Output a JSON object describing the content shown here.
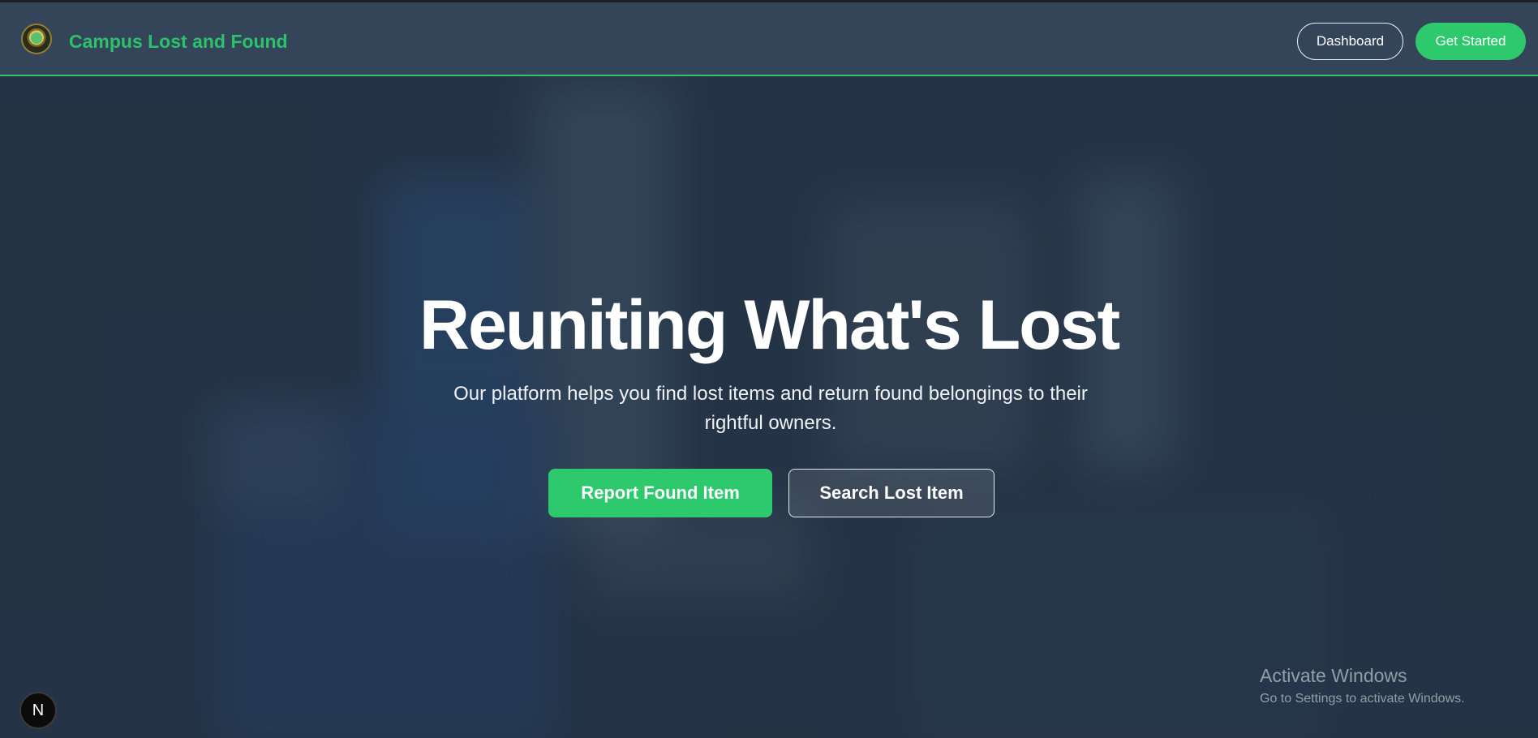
{
  "header": {
    "brand": "Campus Lost and Found",
    "logo_icon": "campus-logo-icon",
    "dashboard_label": "Dashboard",
    "get_started_label": "Get Started"
  },
  "hero": {
    "title": "Reuniting What's Lost",
    "subtitle": "Our platform helps you find lost items and return found belongings to their rightful owners.",
    "report_button": "Report Found Item",
    "search_button": "Search Lost Item"
  },
  "badge": {
    "letter": "N"
  },
  "watermark": {
    "title": "Activate Windows",
    "subtitle": "Go to Settings to activate Windows."
  },
  "colors": {
    "accent": "#2ec86d",
    "header_bg": "#344459",
    "page_bg": "#293849"
  }
}
